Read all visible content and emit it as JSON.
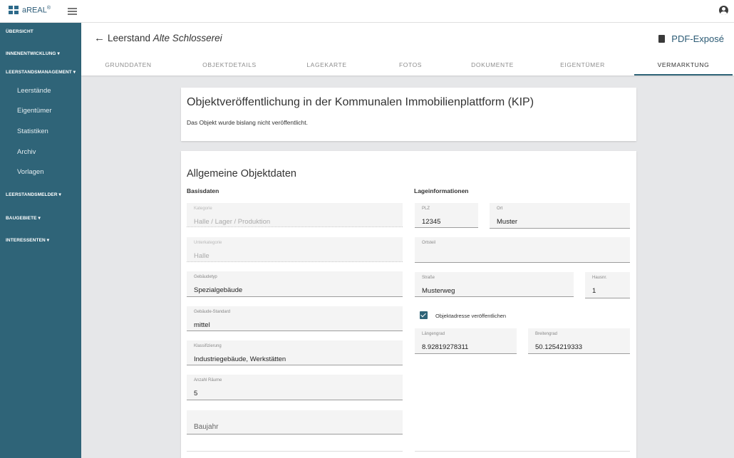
{
  "app": {
    "logo_text": "aREAL",
    "logo_reg": "®"
  },
  "sidebar": {
    "sections": [
      {
        "label": "ÜBERSICHT"
      },
      {
        "label": "INNENENTWICKLUNG ▾"
      },
      {
        "label": "LEERSTANDSMANAGEMENT ▾"
      },
      {
        "label": "LEERSTANDSMELDER ▾"
      },
      {
        "label": "BAUGEBIETE ▾"
      },
      {
        "label": "INTERESSENTEN ▾"
      }
    ],
    "items": [
      {
        "label": "Leerstände"
      },
      {
        "label": "Eigentümer"
      },
      {
        "label": "Statistiken"
      },
      {
        "label": "Archiv"
      },
      {
        "label": "Vorlagen"
      }
    ]
  },
  "header": {
    "back_icon": "←",
    "title_prefix": "Leerstand ",
    "title_name": "Alte Schlosserei",
    "pdf_label": "PDF-Exposé",
    "tabs": [
      {
        "label": "GRUNDDATEN"
      },
      {
        "label": "OBJEKTDETAILS"
      },
      {
        "label": "LAGEKARTE"
      },
      {
        "label": "FOTOS"
      },
      {
        "label": "DOKUMENTE"
      },
      {
        "label": "EIGENTÜMER"
      },
      {
        "label": "VERMARKTUNG"
      }
    ],
    "active_tab": "VERMARKTUNG"
  },
  "kip": {
    "title": "Objektveröffentlichung in der Kommunalen Immobilienplattform (KIP)",
    "text": "Das Objekt wurde bislang nicht veröffentlicht."
  },
  "objekt": {
    "title": "Allgemeine Objektdaten",
    "basis_head": "Basisdaten",
    "lage_head": "Lageinformationen",
    "kategorie": {
      "label": "Kategorie",
      "value": "Halle / Lager / Produktion"
    },
    "unterkategorie": {
      "label": "Unterkategorie",
      "value": "Halle"
    },
    "gebaeudetyp": {
      "label": "Gebäudetyp",
      "value": "Spezialgebäude"
    },
    "standard": {
      "label": "Gebäude-Standard",
      "value": "mittel"
    },
    "klassifizierung": {
      "label": "Klassifizierung",
      "value": "Industriegebäude, Werkstätten"
    },
    "raeume": {
      "label": "Anzahl Räume",
      "value": "5"
    },
    "baujahr": {
      "placeholder": "Baujahr"
    },
    "plz": {
      "label": "PLZ",
      "value": "12345"
    },
    "ort": {
      "label": "Ort",
      "value": "Muster"
    },
    "ortsteil": {
      "label": "Ortsteil",
      "value": ""
    },
    "strasse": {
      "label": "Straße",
      "value": "Musterweg"
    },
    "hausnr": {
      "label": "Hausnr.",
      "value": "1"
    },
    "publish_address": {
      "label": "Objektadresse veröffentlichen",
      "checked": true
    },
    "laengengrad": {
      "label": "Längengrad",
      "value": "8.92819278311"
    },
    "breitengrad": {
      "label": "Breitengrad",
      "value": "50.1254219333"
    }
  },
  "colors": {
    "sidebar": "#2f6478",
    "accent": "#2b5a74"
  }
}
